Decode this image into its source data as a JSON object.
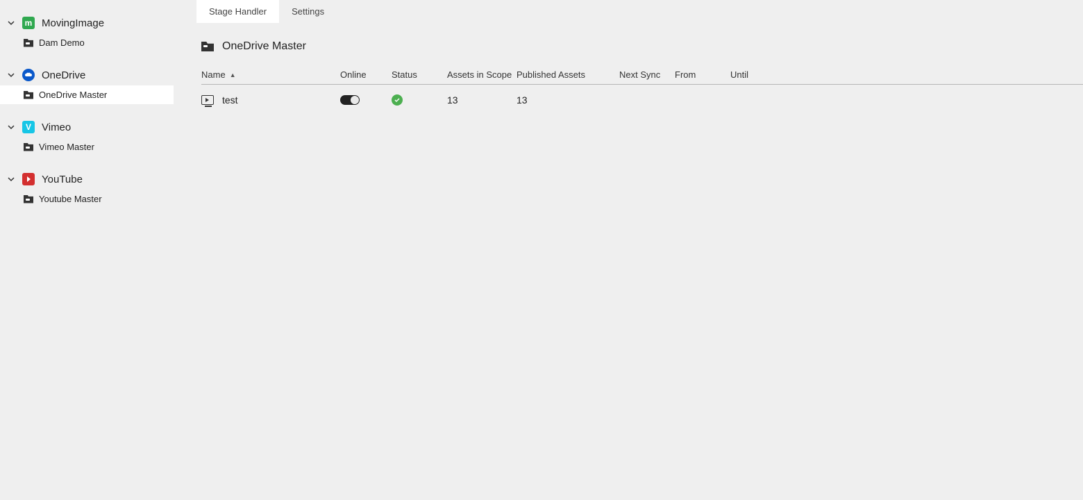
{
  "sidebar": {
    "groups": [
      {
        "label": "MovingImage",
        "brand": "mi",
        "brand_text": "m",
        "children": [
          {
            "label": "Dam Demo",
            "active": false
          }
        ]
      },
      {
        "label": "OneDrive",
        "brand": "od",
        "brand_text": "",
        "children": [
          {
            "label": "OneDrive Master",
            "active": true
          }
        ]
      },
      {
        "label": "Vimeo",
        "brand": "vm",
        "brand_text": "V",
        "children": [
          {
            "label": "Vimeo Master",
            "active": false
          }
        ]
      },
      {
        "label": "YouTube",
        "brand": "yt",
        "brand_text": "",
        "children": [
          {
            "label": "Youtube Master",
            "active": false
          }
        ]
      }
    ]
  },
  "tabs": [
    {
      "label": "Stage Handler",
      "active": true
    },
    {
      "label": "Settings",
      "active": false
    }
  ],
  "page": {
    "title": "OneDrive Master"
  },
  "table": {
    "columns": [
      "Name",
      "Online",
      "Status",
      "Assets in Scope",
      "Published Assets",
      "Next Sync",
      "From",
      "Until"
    ],
    "sort_column": "Name",
    "rows": [
      {
        "name": "test",
        "online": true,
        "status": "ok",
        "assets_in_scope": "13",
        "published_assets": "13",
        "next_sync": "",
        "from": "",
        "until": ""
      }
    ]
  }
}
